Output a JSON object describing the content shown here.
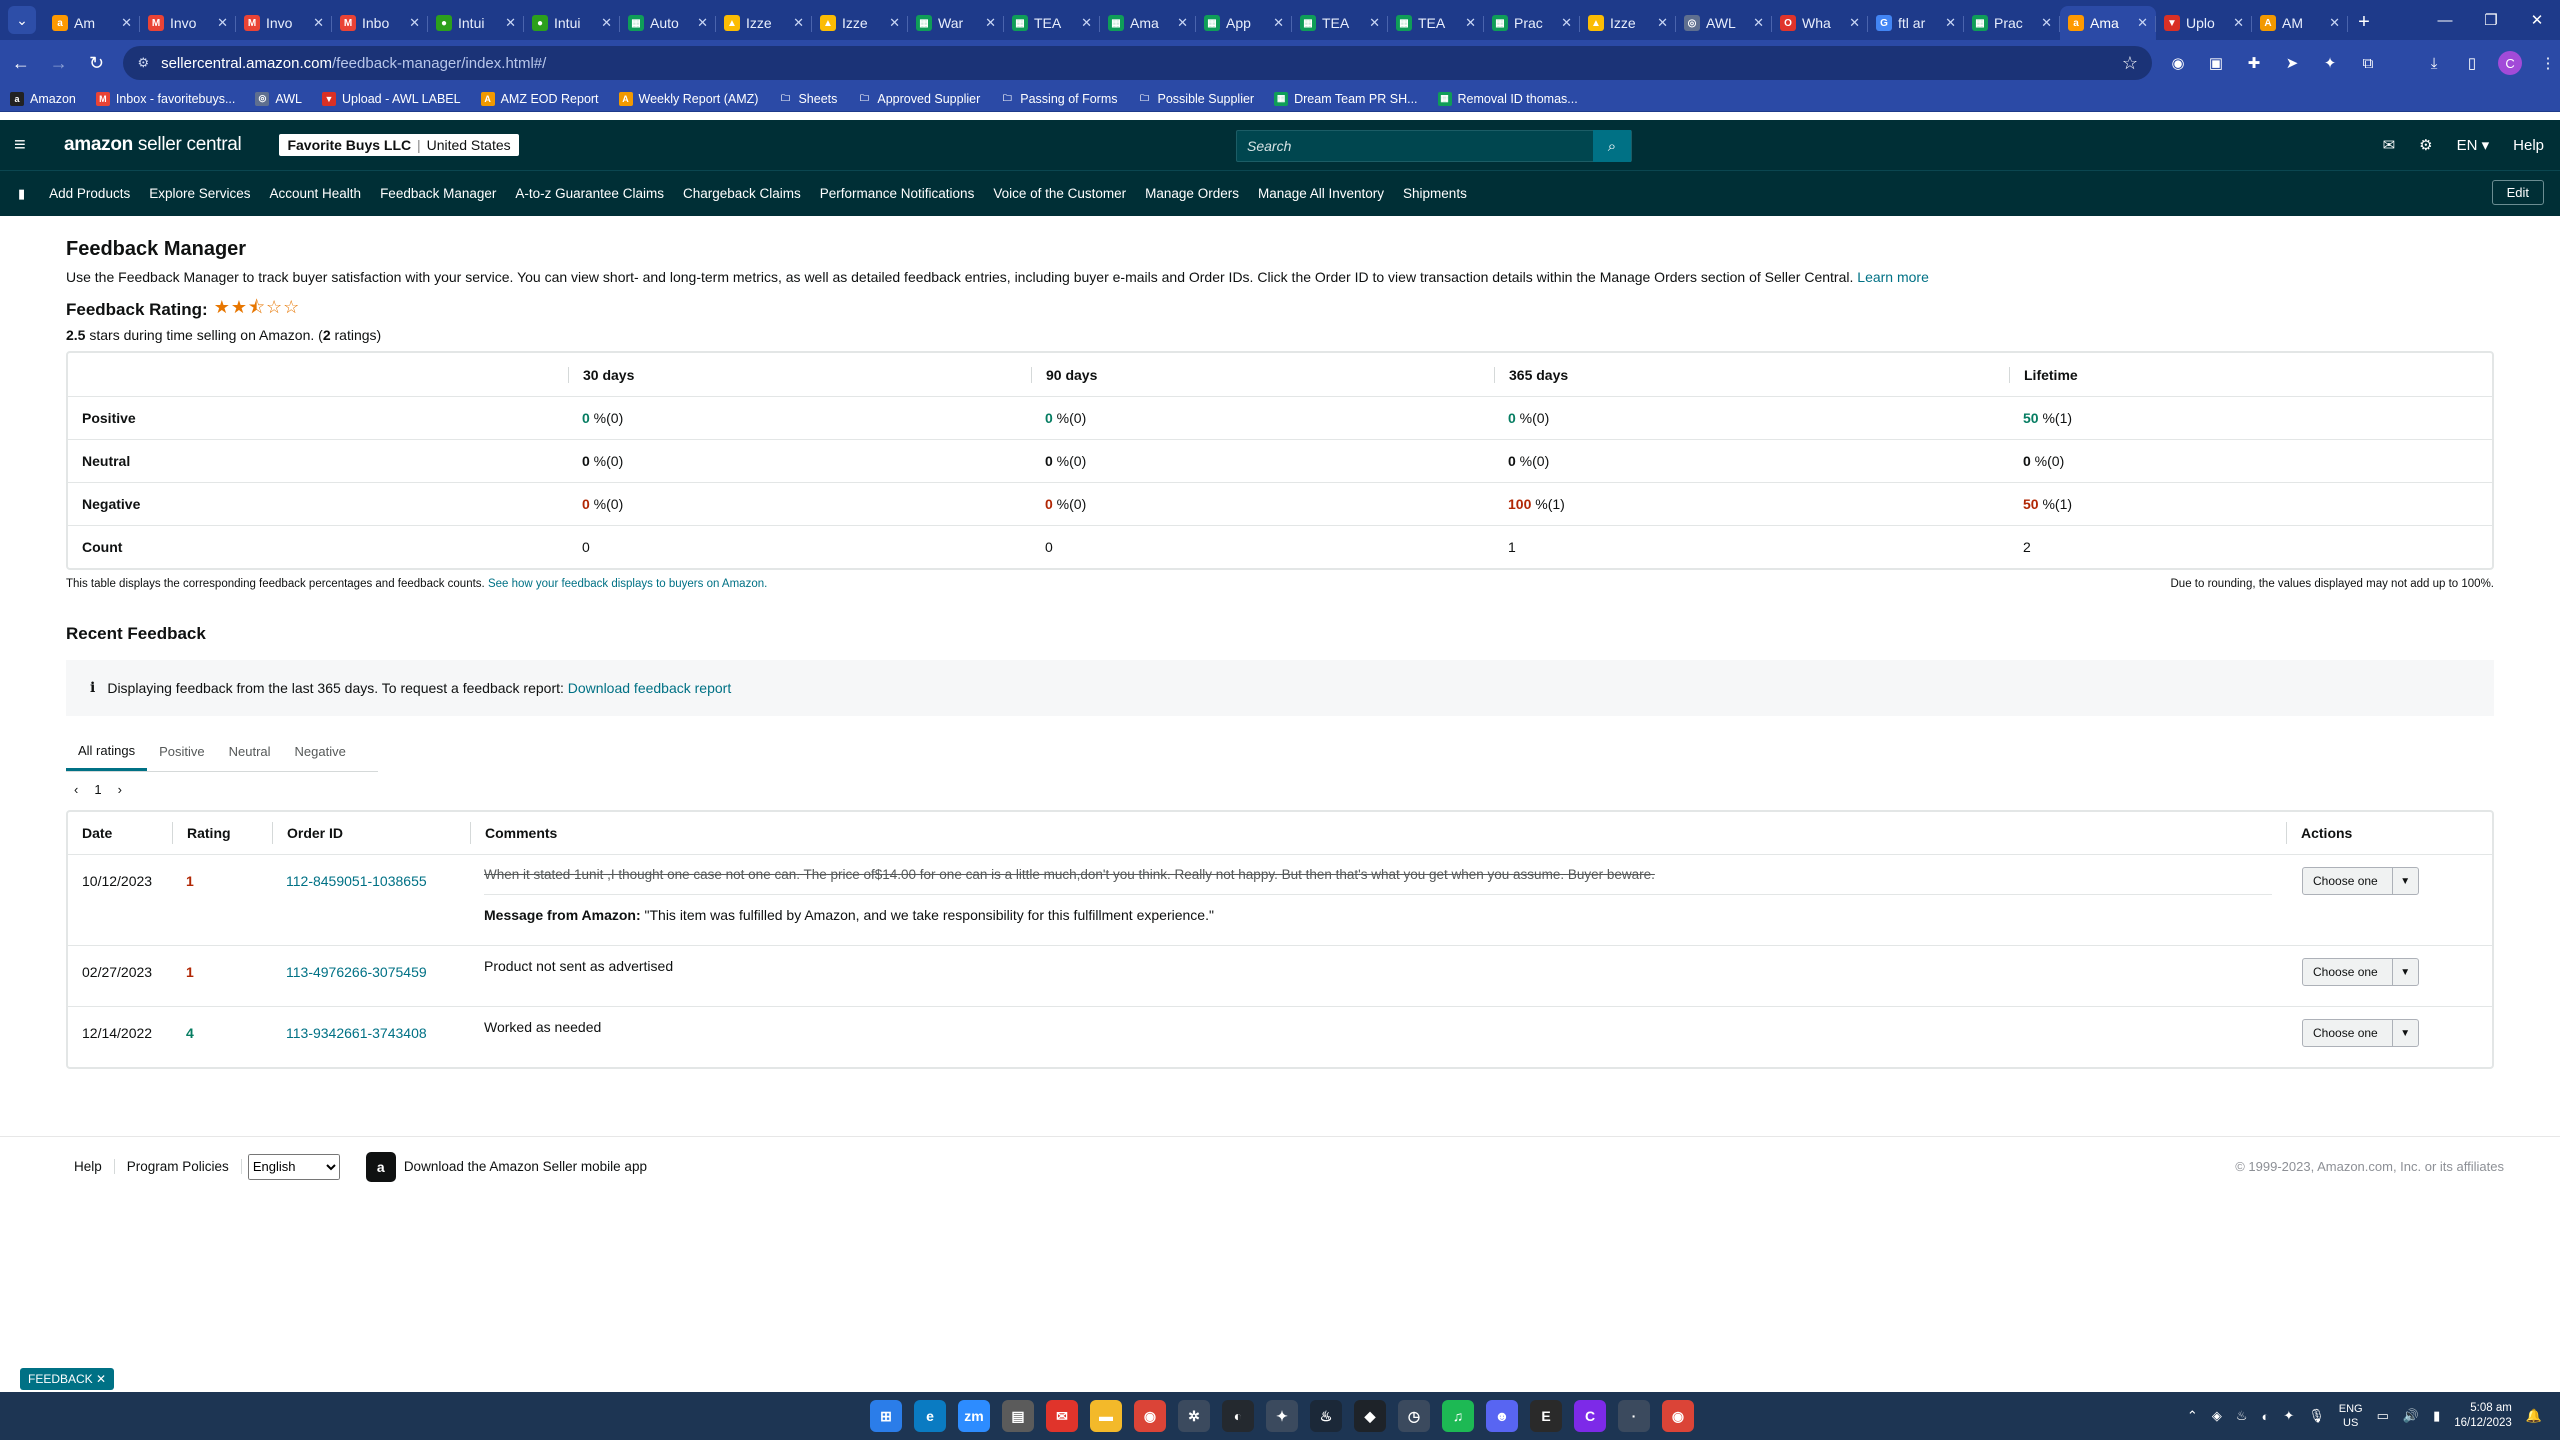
{
  "browser": {
    "tabs": [
      {
        "title": "Am",
        "icon": "amazon-icon",
        "color": "#ff9900",
        "glyph": "a"
      },
      {
        "title": "Invo",
        "icon": "gmail-icon",
        "color": "#ea4335",
        "glyph": "M"
      },
      {
        "title": "Invo",
        "icon": "gmail-icon",
        "color": "#ea4335",
        "glyph": "M"
      },
      {
        "title": "Inbo",
        "icon": "gmail-icon",
        "color": "#ea4335",
        "glyph": "M"
      },
      {
        "title": "Intui",
        "icon": "intuit-icon",
        "color": "#2ca01c",
        "glyph": "●"
      },
      {
        "title": "Intui",
        "icon": "intuit-icon",
        "color": "#2ca01c",
        "glyph": "●"
      },
      {
        "title": "Auto",
        "icon": "sheets-icon",
        "color": "#0f9d58",
        "glyph": "▦"
      },
      {
        "title": "Izze",
        "icon": "drive-icon",
        "color": "#fbbc04",
        "glyph": "▲"
      },
      {
        "title": "Izze",
        "icon": "drive-icon",
        "color": "#fbbc04",
        "glyph": "▲"
      },
      {
        "title": "War",
        "icon": "sheets-icon",
        "color": "#0f9d58",
        "glyph": "▦"
      },
      {
        "title": "TEA",
        "icon": "sheets-icon",
        "color": "#0f9d58",
        "glyph": "▦"
      },
      {
        "title": "Ama",
        "icon": "sheets-icon",
        "color": "#0f9d58",
        "glyph": "▦"
      },
      {
        "title": "App",
        "icon": "sheets-icon",
        "color": "#0f9d58",
        "glyph": "▦"
      },
      {
        "title": "TEA",
        "icon": "sheets-icon",
        "color": "#0f9d58",
        "glyph": "▦"
      },
      {
        "title": "TEA",
        "icon": "sheets-icon",
        "color": "#0f9d58",
        "glyph": "▦"
      },
      {
        "title": "Prac",
        "icon": "sheets-icon",
        "color": "#0f9d58",
        "glyph": "▦"
      },
      {
        "title": "Izze",
        "icon": "drive-icon",
        "color": "#fbbc04",
        "glyph": "▲"
      },
      {
        "title": "AWL",
        "icon": "globe-icon",
        "color": "#5f6f8f",
        "glyph": "◎"
      },
      {
        "title": "Wha",
        "icon": "opera-icon",
        "color": "#e0342b",
        "glyph": "O"
      },
      {
        "title": "ftl ar",
        "icon": "google-icon",
        "color": "#4285f4",
        "glyph": "G"
      },
      {
        "title": "Prac",
        "icon": "sheets-icon",
        "color": "#0f9d58",
        "glyph": "▦"
      },
      {
        "title": "Ama",
        "icon": "amazon-icon",
        "color": "#ff9900",
        "glyph": "a",
        "active": true
      },
      {
        "title": "Uplo",
        "icon": "upload-icon",
        "color": "#d93025",
        "glyph": "▼"
      },
      {
        "title": "AM",
        "icon": "amz-icon",
        "color": "#f29900",
        "glyph": "A"
      }
    ],
    "url_host": "sellercentral.amazon.com",
    "url_path": "/feedback-manager/index.html#/",
    "bookmarks": [
      {
        "label": "Amazon",
        "icon": "amazon-icon",
        "color": "#222",
        "glyph": "a"
      },
      {
        "label": "Inbox - favoritebuys...",
        "icon": "gmail-icon",
        "color": "#ea4335",
        "glyph": "M"
      },
      {
        "label": "AWL",
        "icon": "globe-icon",
        "color": "#5f6f8f",
        "glyph": "◎"
      },
      {
        "label": "Upload - AWL LABEL",
        "icon": "upload-icon",
        "color": "#d93025",
        "glyph": "▼"
      },
      {
        "label": "AMZ EOD Report",
        "icon": "amz-icon",
        "color": "#f29900",
        "glyph": "A"
      },
      {
        "label": "Weekly Report (AMZ)",
        "icon": "amz-icon",
        "color": "#f29900",
        "glyph": "A"
      },
      {
        "label": "Sheets",
        "icon": "folder-icon",
        "color": "transparent",
        "glyph": "🗀"
      },
      {
        "label": "Approved Supplier",
        "icon": "folder-icon",
        "color": "transparent",
        "glyph": "🗀"
      },
      {
        "label": "Passing of Forms",
        "icon": "folder-icon",
        "color": "transparent",
        "glyph": "🗀"
      },
      {
        "label": "Possible Supplier",
        "icon": "folder-icon",
        "color": "transparent",
        "glyph": "🗀"
      },
      {
        "label": "Dream Team PR SH...",
        "icon": "sheets-icon",
        "color": "#0f9d58",
        "glyph": "▦"
      },
      {
        "label": "Removal ID thomas...",
        "icon": "sheets-icon",
        "color": "#0f9d58",
        "glyph": "▦"
      }
    ]
  },
  "header": {
    "logo_bold": "amazon",
    "logo_rest": " seller central",
    "account_name": "Favorite Buys LLC",
    "account_region": "United States",
    "search_placeholder": "Search",
    "lang": "EN ▾",
    "help": "Help"
  },
  "nav": {
    "links": [
      "Add Products",
      "Explore Services",
      "Account Health",
      "Feedback Manager",
      "A-to-z Guarantee Claims",
      "Chargeback Claims",
      "Performance Notifications",
      "Voice of the Customer",
      "Manage Orders",
      "Manage All Inventory",
      "Shipments"
    ],
    "edit": "Edit"
  },
  "page": {
    "title": "Feedback Manager",
    "description": "Use the Feedback Manager to track buyer satisfaction with your service. You can view short- and long-term metrics, as well as detailed feedback entries, including buyer e-mails and Order IDs. Click the Order ID to view transaction details within the Manage Orders section of Seller Central.",
    "learn_more": "Learn more",
    "rating_label": "Feedback Rating:",
    "rating_stars": 2.5,
    "rating_value": "2.5",
    "rating_sub_mid": " stars during time selling on Amazon. (",
    "rating_count": "2",
    "rating_sub_end": " ratings)"
  },
  "metrics": {
    "columns": [
      "30 days",
      "90 days",
      "365 days",
      "Lifetime"
    ],
    "rows": [
      {
        "label": "Positive",
        "kind": "pos",
        "values": [
          [
            "0",
            " %(0)"
          ],
          [
            "0",
            " %(0)"
          ],
          [
            "0",
            " %(0)"
          ],
          [
            "50",
            " %(1)"
          ]
        ]
      },
      {
        "label": "Neutral",
        "kind": "neu",
        "values": [
          [
            "0",
            " %(0)"
          ],
          [
            "0",
            " %(0)"
          ],
          [
            "0",
            " %(0)"
          ],
          [
            "0",
            " %(0)"
          ]
        ]
      },
      {
        "label": "Negative",
        "kind": "neg",
        "values": [
          [
            "0",
            " %(0)"
          ],
          [
            "0",
            " %(0)"
          ],
          [
            "100",
            " %(1)"
          ],
          [
            "50",
            " %(1)"
          ]
        ]
      },
      {
        "label": "Count",
        "kind": "count",
        "values": [
          [
            "0",
            ""
          ],
          [
            "0",
            ""
          ],
          [
            "1",
            ""
          ],
          [
            "2",
            ""
          ]
        ]
      }
    ],
    "foot_left": "This table displays the corresponding feedback percentages and feedback counts.",
    "foot_left_link": "See how your feedback displays to buyers on Amazon.",
    "foot_right": "Due to rounding, the values displayed may not add up to 100%."
  },
  "recent": {
    "title": "Recent Feedback",
    "info_text": "Displaying feedback from the last 365 days. To request a feedback report:",
    "info_link": "Download feedback report",
    "filter_tabs": [
      "All ratings",
      "Positive",
      "Neutral",
      "Negative"
    ],
    "page_number": "1",
    "columns": [
      "Date",
      "Rating",
      "Order ID",
      "Comments",
      "Actions"
    ],
    "choose_label": "Choose one",
    "rows": [
      {
        "date": "10/12/2023",
        "rating": "1",
        "order_id": "112-8459051-1038655",
        "comment": "When it stated 1unit ,I thought one case not one can. The price of$14.00 for one can is a little much,don't you think. Really not happy. But then that's what you get when you assume. Buyer beware.",
        "struck": true,
        "amazon_message_label": "Message from Amazon:",
        "amazon_message": " \"This item was fulfilled by Amazon, and we take responsibility for this fulfillment experience.\""
      },
      {
        "date": "02/27/2023",
        "rating": "1",
        "order_id": "113-4976266-3075459",
        "comment": "Product not sent as advertised",
        "struck": false
      },
      {
        "date": "12/14/2022",
        "rating": "4",
        "order_id": "113-9342661-3743408",
        "comment": "Worked as needed",
        "struck": false
      }
    ]
  },
  "footer": {
    "links": [
      "Help",
      "Program Policies"
    ],
    "language": "English",
    "app_text": "Download the Amazon Seller mobile app",
    "copyright": "© 1999-2023, Amazon.com, Inc. or its affiliates"
  },
  "feedback_tab": "FEEDBACK ✕",
  "taskbar": {
    "apps": [
      {
        "name": "start-icon",
        "color": "#2b7de9",
        "glyph": "⊞"
      },
      {
        "name": "edge-icon",
        "color": "#0a7bc2",
        "glyph": "e"
      },
      {
        "name": "zoom-icon",
        "color": "#2d8cff",
        "glyph": "zm"
      },
      {
        "name": "calculator-icon",
        "color": "#5b5b5b",
        "glyph": "▤"
      },
      {
        "name": "mail-icon",
        "color": "#e0342b",
        "glyph": "✉"
      },
      {
        "name": "explorer-icon",
        "color": "#f3b92a",
        "glyph": "▬"
      },
      {
        "name": "chrome-icon",
        "color": "#db4437",
        "glyph": "◉"
      },
      {
        "name": "settings-icon",
        "color": "#3b4a5e",
        "glyph": "✲"
      },
      {
        "name": "github-icon",
        "color": "#24292f",
        "glyph": "◐"
      },
      {
        "name": "feather-icon",
        "color": "#3b4a5e",
        "glyph": "✦"
      },
      {
        "name": "steam-icon",
        "color": "#1b2838",
        "glyph": "♨"
      },
      {
        "name": "binance-icon",
        "color": "#1e2329",
        "glyph": "◆"
      },
      {
        "name": "clock-app-icon",
        "color": "#3b4a5e",
        "glyph": "◷"
      },
      {
        "name": "spotify-icon",
        "color": "#1db954",
        "glyph": "♫"
      },
      {
        "name": "discord-icon",
        "color": "#5865f2",
        "glyph": "☻"
      },
      {
        "name": "epic-icon",
        "color": "#2a2a2a",
        "glyph": "E"
      },
      {
        "name": "canva-icon",
        "color": "#7d2ae8",
        "glyph": "C"
      },
      {
        "name": "blank-app-icon",
        "color": "#3b4a5e",
        "glyph": "·"
      },
      {
        "name": "chrome-alt-icon",
        "color": "#db4437",
        "glyph": "◉"
      }
    ],
    "lang_line1": "ENG",
    "lang_line2": "US",
    "time": "5:08 am",
    "date": "16/12/2023"
  }
}
